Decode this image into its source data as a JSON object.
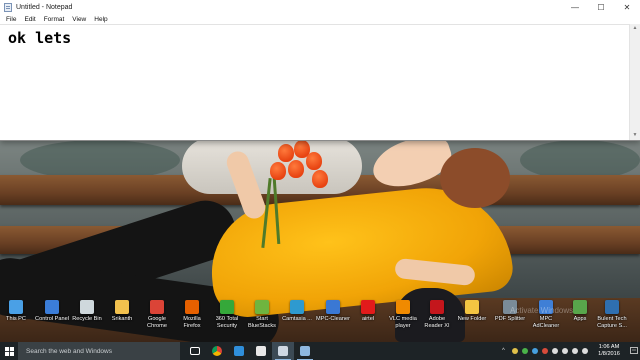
{
  "notepad": {
    "title": "Untitled - Notepad",
    "menu": [
      "File",
      "Edit",
      "Format",
      "View",
      "Help"
    ],
    "content": "ok lets",
    "minimize_glyph": "—",
    "maximize_glyph": "☐",
    "close_glyph": "✕"
  },
  "desktop_icons": [
    {
      "label": "This PC",
      "icon": "computer-icon",
      "color": "#4aa0e6"
    },
    {
      "label": "Control Panel",
      "icon": "control-panel-icon",
      "color": "#3b7dd8"
    },
    {
      "label": "Recycle Bin",
      "icon": "recycle-bin-icon",
      "color": "#cfd8dc"
    },
    {
      "label": "Srikanth",
      "icon": "user-folder-icon",
      "color": "#f2c14e"
    },
    {
      "label": "Google Chrome",
      "icon": "chrome-icon",
      "color": "#db4437"
    },
    {
      "label": "Mozilla Firefox",
      "icon": "firefox-icon",
      "color": "#e66000"
    },
    {
      "label": "360 Total Security",
      "icon": "security-icon",
      "color": "#35a83a"
    },
    {
      "label": "Start BlueStacks",
      "icon": "bluestacks-icon",
      "color": "#6fb53f"
    },
    {
      "label": "Camtasia ...",
      "icon": "camtasia-icon",
      "color": "#2e9ad0"
    },
    {
      "label": "MPC-Cleaner",
      "icon": "mpc-cleaner-icon",
      "color": "#3a78d4"
    },
    {
      "label": "airtel",
      "icon": "airtel-icon",
      "color": "#e21b1b"
    },
    {
      "label": "VLC media player",
      "icon": "vlc-icon",
      "color": "#f08a00"
    },
    {
      "label": "Adobe Reader XI",
      "icon": "adobe-reader-icon",
      "color": "#c4161c"
    },
    {
      "label": "New Folder",
      "icon": "folder-icon",
      "color": "#f4c542"
    },
    {
      "label": "PDF Splitter",
      "icon": "pdf-splitter-icon",
      "color": "#7a8b98"
    },
    {
      "label": "MPC AdCleaner",
      "icon": "adcleaner-icon",
      "color": "#3f7fd6"
    },
    {
      "label": "Apps",
      "icon": "apps-icon",
      "color": "#58a64b"
    },
    {
      "label": "Bulent Tech Capture S...",
      "icon": "capture-icon",
      "color": "#2f6fb0"
    }
  ],
  "watermark": "Activate Windows",
  "taskbar": {
    "search_placeholder": "Search the web and Windows",
    "pinned": [
      {
        "name": "task-view-icon",
        "color": "#ffffff"
      },
      {
        "name": "chrome-icon",
        "color": "#db4437"
      },
      {
        "name": "edge-icon",
        "color": "#2f8fdb"
      },
      {
        "name": "store-icon",
        "color": "#e8e8e8"
      },
      {
        "name": "notepad-task-icon",
        "color": "#cfd8e3"
      },
      {
        "name": "windows-explorer-icon",
        "color": "#8fb8e0"
      }
    ],
    "tray": [
      {
        "name": "chevron-up-icon",
        "color": "#dddddd"
      },
      {
        "name": "tray-app-1-icon",
        "color": "#e0c04a"
      },
      {
        "name": "tray-app-2-icon",
        "color": "#4ab34a"
      },
      {
        "name": "tray-app-3-icon",
        "color": "#46a0e0"
      },
      {
        "name": "tray-app-4-icon",
        "color": "#d84b3a"
      },
      {
        "name": "battery-icon",
        "color": "#dddddd"
      },
      {
        "name": "wifi-icon",
        "color": "#dddddd"
      },
      {
        "name": "volume-icon",
        "color": "#dddddd"
      },
      {
        "name": "keyboard-icon",
        "color": "#dddddd"
      }
    ],
    "time": "1:06 AM",
    "date": "1/8/2016"
  }
}
